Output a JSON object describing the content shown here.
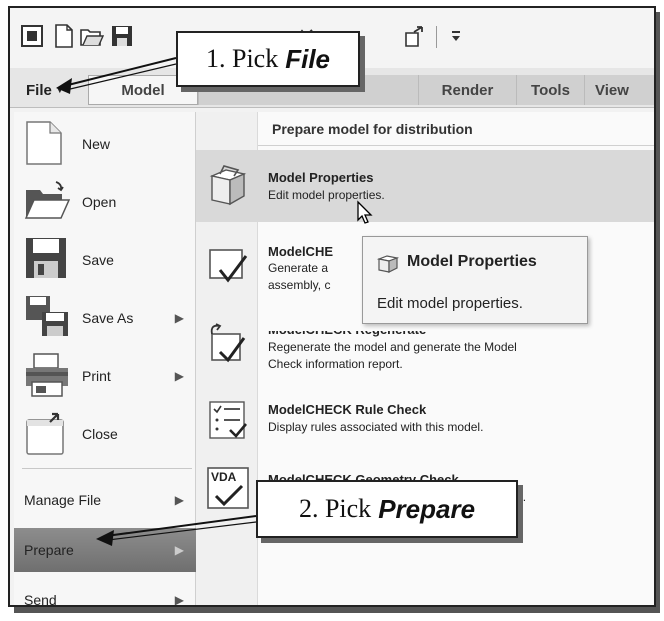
{
  "ribbon": {
    "tabs": [
      "File",
      "Model",
      "Render",
      "Tools",
      "View"
    ]
  },
  "file_menu": {
    "left_items": [
      {
        "label": "New",
        "icon": "new-document-icon",
        "has_submenu": false
      },
      {
        "label": "Open",
        "icon": "open-folder-icon",
        "has_submenu": false
      },
      {
        "label": "Save",
        "icon": "save-disk-icon",
        "has_submenu": false
      },
      {
        "label": "Save As",
        "icon": "save-as-icon",
        "has_submenu": true
      },
      {
        "label": "Print",
        "icon": "printer-icon",
        "has_submenu": true
      },
      {
        "label": "Close",
        "icon": "close-window-icon",
        "has_submenu": false
      }
    ],
    "lower_items": [
      {
        "label": "Manage File",
        "has_submenu": true
      },
      {
        "label": "Prepare",
        "has_submenu": true,
        "selected": true
      },
      {
        "label": "Send",
        "has_submenu": true
      }
    ]
  },
  "prepare_panel": {
    "header": "Prepare model for distribution",
    "entries": [
      {
        "title": "Model Properties",
        "desc": [
          "Edit model properties."
        ],
        "icon": "model-properties-icon"
      },
      {
        "title": "ModelCHE",
        "desc": [
          "Generate a",
          "assembly, c"
        ],
        "icon": "modelcheck-icon"
      },
      {
        "title": "ModelCHECK Regenerate",
        "desc": [
          "Regenerate the model and generate the Model",
          "Check information report."
        ],
        "icon": "modelcheck-regenerate-icon"
      },
      {
        "title": "ModelCHECK Rule Check",
        "desc": [
          "Display rules associated with this model."
        ],
        "icon": "rule-check-icon"
      },
      {
        "title": "ModelCHECK Geometry Check",
        "desc": [
          "tandard."
        ],
        "icon": "vda-geometry-check-icon"
      }
    ]
  },
  "tooltip": {
    "title": "Model Properties",
    "desc": "Edit model properties."
  },
  "callouts": {
    "step1_prefix": "1. Pick",
    "step1_emph": "File",
    "step2_prefix": "2. Pick",
    "step2_emph": "Prepare"
  },
  "colors": {
    "highlight": "#d9d9d9",
    "selected_item": "#7d7d7d",
    "frame": "#222222"
  }
}
